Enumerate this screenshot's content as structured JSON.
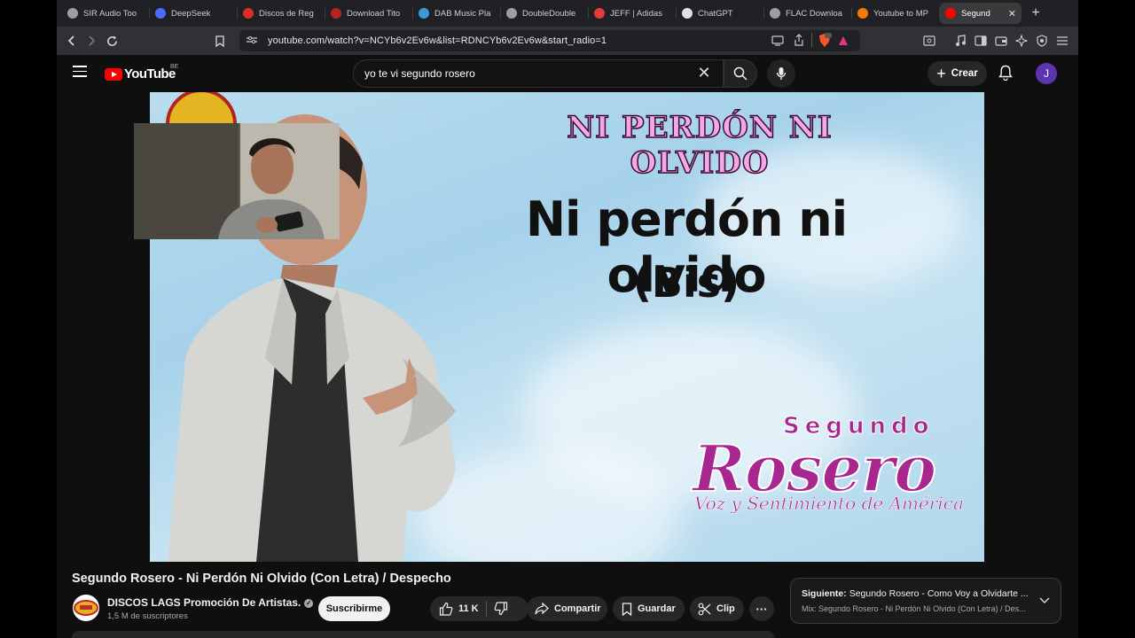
{
  "browser": {
    "tabs": [
      {
        "title": "SIR Audio Too",
        "icon": "apple-icon",
        "color": "#9e9e9e"
      },
      {
        "title": "DeepSeek",
        "icon": "deepseek-icon",
        "color": "#4d6bfe"
      },
      {
        "title": "Discos de Reg",
        "icon": "discos-icon",
        "color": "#d93025"
      },
      {
        "title": "Download Tito",
        "icon": "download-icon",
        "color": "#b3261e"
      },
      {
        "title": "DAB Music Pla",
        "icon": "dab-icon",
        "color": "#3a9ad9"
      },
      {
        "title": "DoubleDouble",
        "icon": "globe-icon",
        "color": "#9e9e9e"
      },
      {
        "title": "JEFF | Adidas",
        "icon": "rocket-icon",
        "color": "#e53935"
      },
      {
        "title": "ChatGPT",
        "icon": "chatgpt-icon",
        "color": "#e0e0e0"
      },
      {
        "title": "FLAC Downloa",
        "icon": "globe-icon",
        "color": "#9e9e9e"
      },
      {
        "title": "Youtube to MP",
        "icon": "ytmp3-icon",
        "color": "#f57c00"
      },
      {
        "title": "Segund",
        "icon": "youtube-icon",
        "color": "#ff0000",
        "active": true
      }
    ],
    "url": "youtube.com/watch?v=NCYb6v2Ev6w&list=RDNCYb6v2Ev6w&start_radio=1"
  },
  "yt": {
    "brand": "YouTube",
    "country": "BE",
    "search_value": "yo te vi segundo rosero",
    "create_label": "Crear",
    "avatar_letter": "J"
  },
  "video_frame": {
    "heading": "NI PERDÓN NI OLVIDO",
    "lyric_line1": "Ni perdón ni olvido",
    "lyric_line2": "(Bis)",
    "artist_top": "Segundo",
    "artist_main": "Rosero",
    "slogan": "Voz y Sentimiento de América"
  },
  "video": {
    "title": "Segundo Rosero - Ni Perdón Ni Olvido (Con Letra) / Despecho",
    "channel": "DISCOS LAGS Promoción De Artistas.",
    "subscribers": "1,5 M de suscriptores",
    "subscribe_label": "Suscribirme",
    "likes": "11 K",
    "share_label": "Compartir",
    "save_label": "Guardar",
    "clip_label": "Clip",
    "more_label": "···"
  },
  "next": {
    "prefix": "Siguiente:",
    "title": "Segundo Rosero - Como Voy a Olvidarte ...",
    "mix": "Mix: Segundo Rosero - Ni Perdón Ni Olvido (Con Letra) / Des..."
  }
}
